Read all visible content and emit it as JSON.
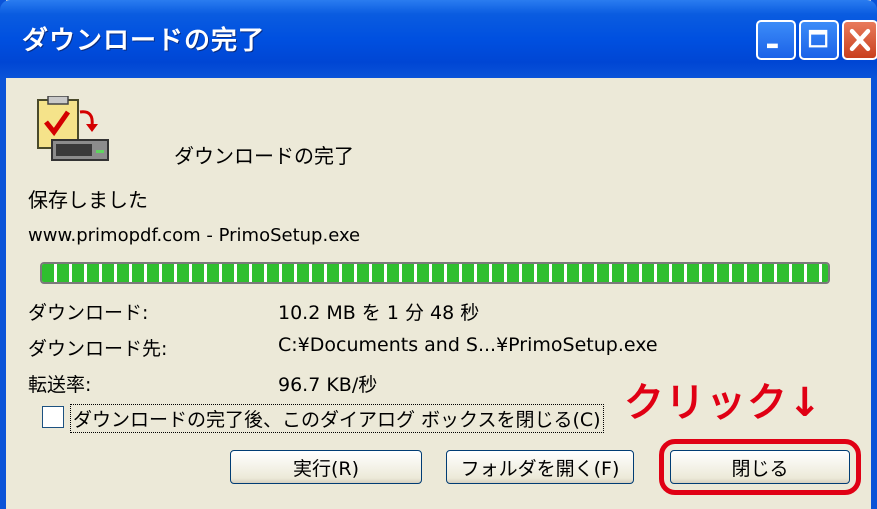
{
  "window": {
    "title": "ダウンロードの完了"
  },
  "header": {
    "label": "ダウンロードの完了",
    "icon": "download-complete-icon"
  },
  "status": {
    "saved": "保存しました",
    "source": "www.primopdf.com - PrimoSetup.exe"
  },
  "progress": {
    "value": 1.0
  },
  "details": [
    {
      "label": "ダウンロード:",
      "value": "10.2 MB を 1 分 48 秒"
    },
    {
      "label": "ダウンロード先:",
      "value": "C:¥Documents and S...¥PrimoSetup.exe"
    },
    {
      "label": "転送率:",
      "value": "96.7 KB/秒"
    }
  ],
  "checkbox": {
    "label": "ダウンロードの完了後、このダイアログ ボックスを閉じる(C)",
    "checked": false
  },
  "annotation": {
    "text": "クリック↓",
    "color": "#e00014"
  },
  "buttons": {
    "run": "実行(R)",
    "open_folder": "フォルダを開く(F)",
    "close": "閉じる"
  },
  "colors": {
    "titlebar": "#0050e0",
    "progress": "#2fbf2f"
  }
}
